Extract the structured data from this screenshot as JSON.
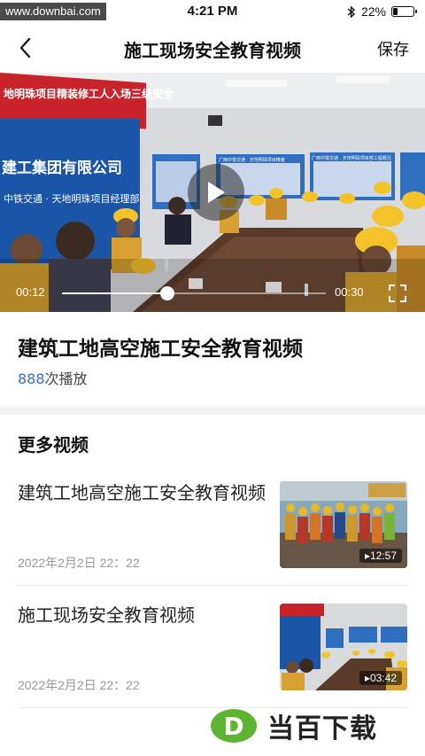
{
  "status": {
    "watermark": "www.downbai.com",
    "time": "4:21 PM",
    "battery": "22%",
    "battery_level": 0.22
  },
  "nav": {
    "title": "施工现场安全教育视频",
    "save": "保存"
  },
  "player": {
    "scene_banner": "地明珠项目精装修工人入场三级安全",
    "scene_company": "建工集团有限公司",
    "scene_sub": "中铁交通 · 天地明珠项目经理部",
    "scene_board_1": "广西中铁交通 · 天地明珠项目精装",
    "scene_board_2": "广西中铁交通 · 天地明珠项目部工程概况",
    "current_time": "00:12",
    "total_time": "00:30",
    "progress": 0.4
  },
  "video": {
    "title": "建筑工地高空施工安全教育视频",
    "plays_count": "888",
    "plays_suffix": "次播放"
  },
  "more": {
    "heading": "更多视频",
    "items": [
      {
        "title": "建筑工地高空施工安全教育视频",
        "date": "2022年2月2日 22：22",
        "duration": "▸12:57"
      },
      {
        "title": "施工现场安全教育视频",
        "date": "2022年2月2日 22：22",
        "duration": "▸03:42"
      }
    ]
  },
  "brand": {
    "logo_letter": "D",
    "name": "当百下载"
  },
  "colors": {
    "accent_blue": "#3a6fc4",
    "brand_green": "#5cb531"
  }
}
